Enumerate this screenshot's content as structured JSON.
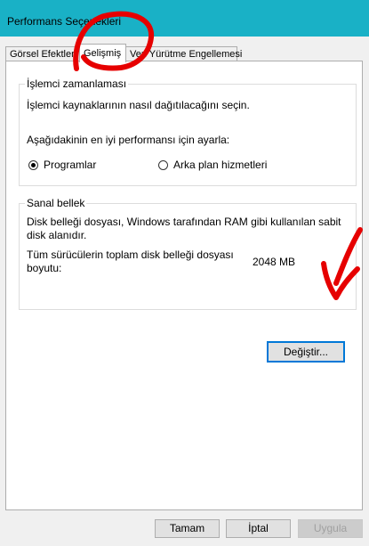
{
  "window": {
    "title": "Performans Seçenekleri"
  },
  "tabs": [
    {
      "label": "Görsel Efektler",
      "active": false
    },
    {
      "label": "Gelişmiş",
      "active": true
    },
    {
      "label": "Veri Yürütme Engellemesi",
      "active": false
    }
  ],
  "processor": {
    "group_label": "İşlemci zamanlaması",
    "description": "İşlemci kaynaklarının nasıl dağıtılacağını seçin.",
    "adjust_label": "Aşağıdakinin en iyi performansı için ayarla:",
    "options": [
      {
        "label": "Programlar",
        "selected": true
      },
      {
        "label": "Arka plan hizmetleri",
        "selected": false
      }
    ]
  },
  "virtual_memory": {
    "group_label": "Sanal bellek",
    "description_line1": "Disk belleği dosyası, Windows tarafından RAM gibi kullanılan sabit",
    "description_line2": "disk alanıdır.",
    "total_label_line1": "Tüm sürücülerin toplam disk belleği dosyası",
    "total_label_line2": "boyutu:",
    "total_value": "2048 MB",
    "change_button": "Değiştir..."
  },
  "footer": {
    "ok": "Tamam",
    "cancel": "İptal",
    "apply": "Uygula"
  },
  "colors": {
    "titlebar": "#19b1c6",
    "annotation": "#e60000",
    "focus": "#0078d7"
  },
  "icons": {
    "radio_selected": "radio-selected-icon",
    "radio_unselected": "radio-unselected-icon"
  }
}
